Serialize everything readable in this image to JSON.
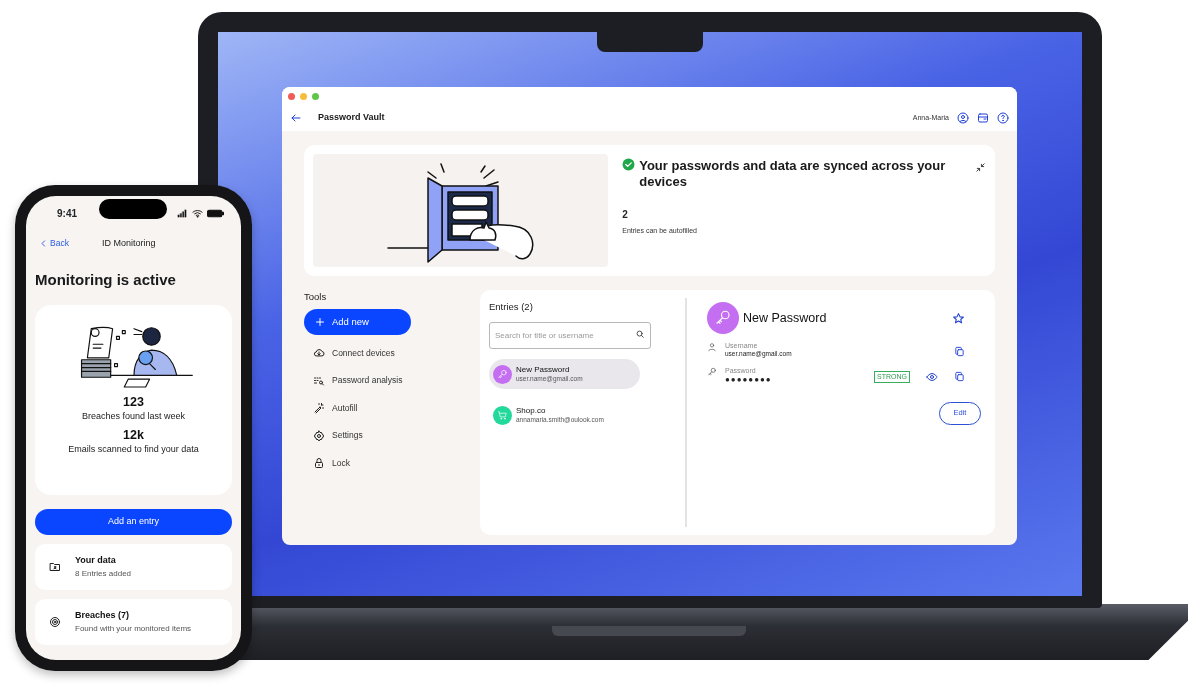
{
  "laptop": {
    "window": {
      "title": "Password Vault",
      "user": "Anna-Maria",
      "banner": {
        "title": "Your passwords and data are synced across your devices",
        "count": "2",
        "caption": "Entries can be autofilled"
      },
      "tools": {
        "heading": "Tools",
        "add_button": "Add new",
        "items": [
          {
            "label": "Connect devices"
          },
          {
            "label": "Password analysis"
          },
          {
            "label": "Autofill"
          },
          {
            "label": "Settings"
          },
          {
            "label": "Lock"
          }
        ]
      },
      "entries": {
        "heading": "Entries (2)",
        "search": {
          "placeholder": "Search for title or username"
        },
        "items": [
          {
            "title": "New Password",
            "subtitle": "user.name@gmail.com",
            "selected": true,
            "color": "#c46ef2"
          },
          {
            "title": "Shop.co",
            "subtitle": "annamaria.smith@oulook.com",
            "selected": false,
            "color": "#22d89a"
          }
        ]
      },
      "detail": {
        "title": "New Password",
        "favorite": false,
        "fields": [
          {
            "label": "Username",
            "value": "user.name@gmail.com",
            "masked": false
          },
          {
            "label": "Password",
            "value": "●●●●●●●●",
            "masked": true,
            "strength": "STRONG"
          }
        ],
        "edit_button": "Edit"
      }
    }
  },
  "phone": {
    "time": "9:41",
    "back": "Back",
    "title": "ID Monitoring",
    "heading": "Monitoring is active",
    "stats": [
      {
        "value": "123",
        "label": "Breaches found last week"
      },
      {
        "value": "12k",
        "label": "Emails scanned to find your data"
      }
    ],
    "button": "Add an entry",
    "cards": [
      {
        "title": "Your data",
        "subtitle": "8 Entries added"
      },
      {
        "title": "Breaches (7)",
        "subtitle": "Found with your monitored items"
      }
    ]
  }
}
